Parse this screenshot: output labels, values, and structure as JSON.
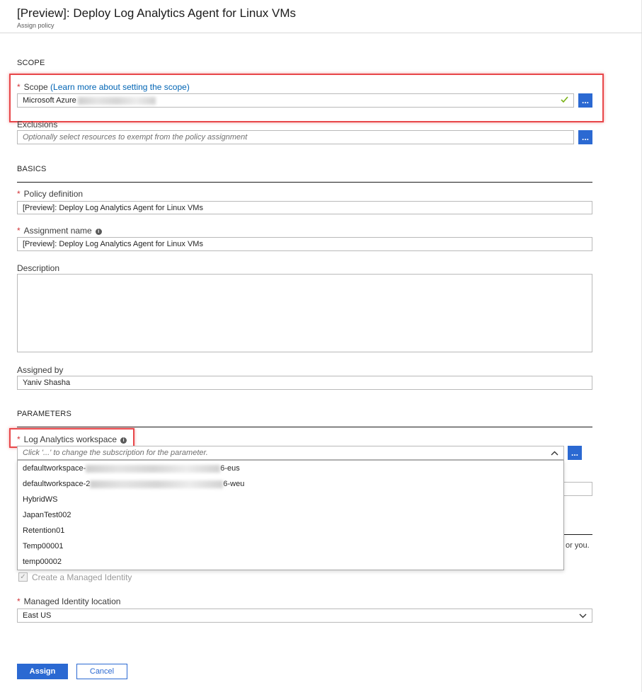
{
  "header": {
    "title": "[Preview]: Deploy Log Analytics Agent for Linux VMs",
    "subtitle": "Assign policy"
  },
  "scope_section": {
    "heading": "SCOPE",
    "scope_label": "Scope",
    "scope_link": "(Learn more about setting the scope)",
    "scope_value": "Microsoft Azure",
    "exclusions_label": "Exclusions",
    "exclusions_placeholder": "Optionally select resources to exempt from the policy assignment",
    "browse_label": "..."
  },
  "basics": {
    "heading": "BASICS",
    "policy_definition_label": "Policy definition",
    "policy_definition_value": "[Preview]: Deploy Log Analytics Agent for Linux VMs",
    "assignment_name_label": "Assignment name",
    "assignment_name_value": "[Preview]: Deploy Log Analytics Agent for Linux VMs",
    "description_label": "Description",
    "description_value": "",
    "assigned_by_label": "Assigned by",
    "assigned_by_value": "Yaniv Shasha"
  },
  "parameters": {
    "heading": "PARAMETERS",
    "workspace_label": "Log Analytics workspace",
    "workspace_placeholder": "Click '...' to change the subscription for the parameter.",
    "workspace_options": [
      {
        "prefix": "defaultworkspace-",
        "suffix": "6-eus"
      },
      {
        "prefix": "defaultworkspace-2",
        "suffix": "6-weu"
      },
      {
        "prefix": "HybridWS",
        "suffix": ""
      },
      {
        "prefix": "JapanTest002",
        "suffix": ""
      },
      {
        "prefix": "Retention01",
        "suffix": ""
      },
      {
        "prefix": "Temp00001",
        "suffix": ""
      },
      {
        "prefix": "temp00002",
        "suffix": ""
      }
    ],
    "partial_text": "or you."
  },
  "managed_identity": {
    "create_label": "Create a Managed Identity",
    "create_checked": true,
    "location_label": "Managed Identity location",
    "location_value": "East US"
  },
  "footer": {
    "assign_label": "Assign",
    "cancel_label": "Cancel"
  },
  "colors": {
    "accent": "#2b69d2",
    "required": "#d13438",
    "highlight": "#e8474a",
    "link": "#0064b4",
    "check": "#7ab317"
  },
  "icons": {
    "valid": "checkmark-icon",
    "info": "info-icon",
    "collapse": "chevron-up-icon",
    "expand": "chevron-down-icon"
  }
}
